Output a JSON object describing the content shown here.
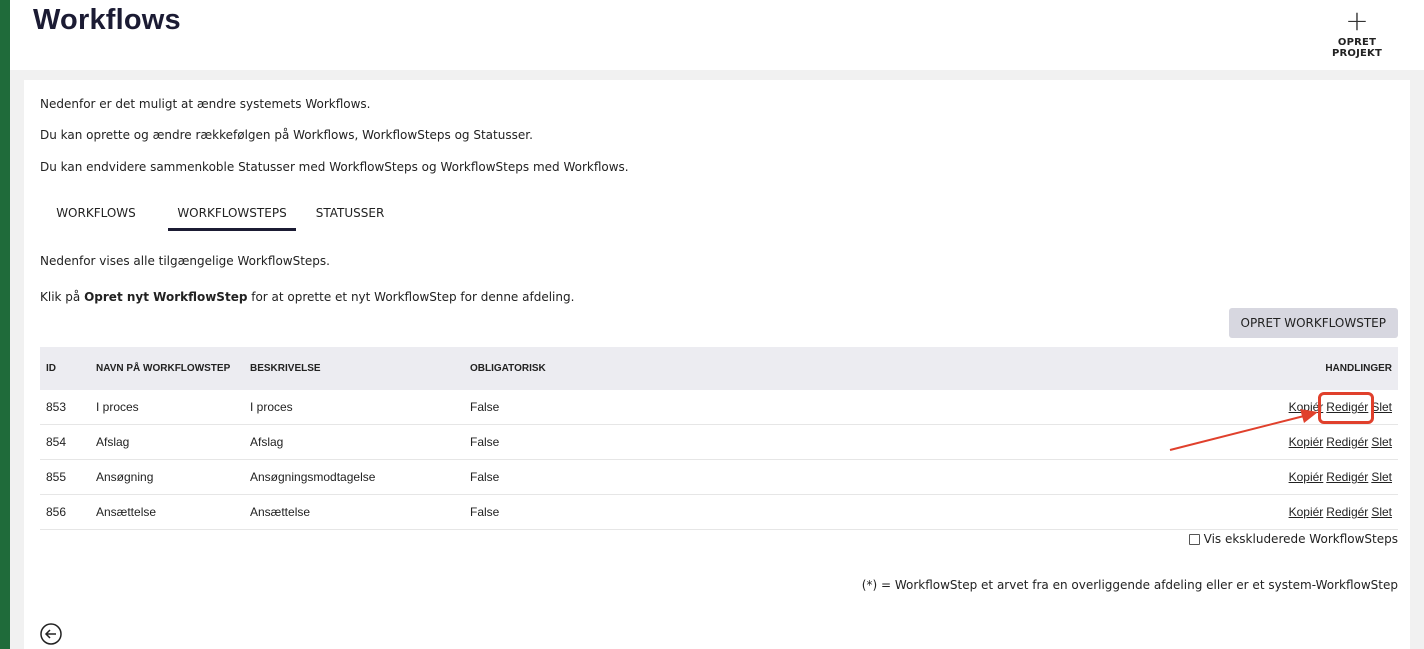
{
  "header": {
    "title": "Workflows",
    "create_project_icon": "+",
    "create_project_label": "OPRET PROJEKT"
  },
  "intro": {
    "line1": "Nedenfor er det muligt at ændre systemets Workflows.",
    "line2": "Du kan oprette og ændre rækkefølgen på Workflows, WorkflowSteps og Statusser.",
    "line3": "Du kan endvidere sammenkoble Statusser med WorkflowSteps og WorkflowSteps med Workflows."
  },
  "tabs": [
    {
      "label": "WORKFLOWS",
      "active": false
    },
    {
      "label": "WORKFLOWSTEPS",
      "active": true
    },
    {
      "label": "STATUSSER",
      "active": false
    }
  ],
  "section": {
    "desc1": "Nedenfor vises alle tilgængelige WorkflowSteps.",
    "desc2_prefix": "Klik på ",
    "desc2_bold": "Opret nyt WorkflowStep",
    "desc2_suffix": " for at oprette et nyt WorkflowStep for denne afdeling.",
    "create_button": "OPRET WORKFLOWSTEP"
  },
  "table": {
    "columns": [
      "ID",
      "NAVN PÅ WORKFLOWSTEP",
      "BESKRIVELSE",
      "OBLIGATORISK",
      "HANDLINGER"
    ],
    "rows": [
      {
        "id": "853",
        "name": "I proces",
        "description": "I proces",
        "mandatory": "False"
      },
      {
        "id": "854",
        "name": "Afslag",
        "description": "Afslag",
        "mandatory": "False"
      },
      {
        "id": "855",
        "name": "Ansøgning",
        "description": "Ansøgningsmodtagelse",
        "mandatory": "False"
      },
      {
        "id": "856",
        "name": "Ansættelse",
        "description": "Ansættelse",
        "mandatory": "False"
      }
    ],
    "actions": {
      "copy": "Kopiér",
      "edit": "Redigér",
      "delete": "Slet"
    }
  },
  "show_excluded_label": "Vis ekskluderede WorkflowSteps",
  "footnote": "(*) = WorkflowStep et arvet fra en overliggende afdeling eller er et system-WorkflowStep",
  "annotation_color": "#e0402c"
}
